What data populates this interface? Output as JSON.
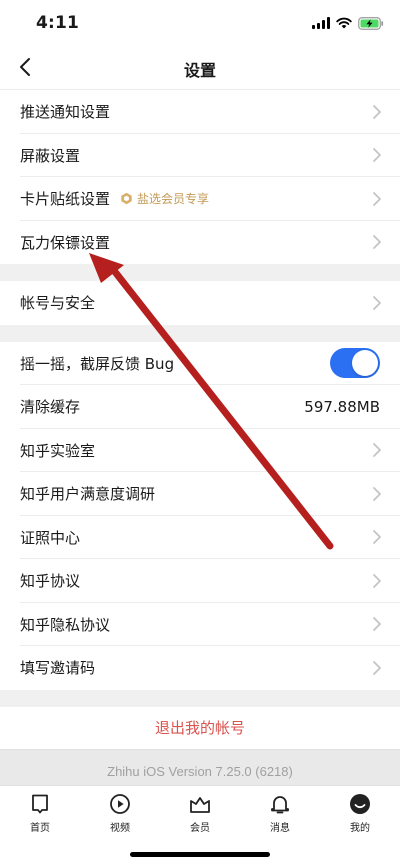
{
  "status": {
    "time": "4:11"
  },
  "nav": {
    "title": "设置"
  },
  "group1": [
    {
      "label": "推送通知设置"
    },
    {
      "label": "屏蔽设置"
    },
    {
      "label": "卡片贴纸设置",
      "badge": "盐选会员专享"
    },
    {
      "label": "瓦力保镖设置"
    }
  ],
  "group2": [
    {
      "label": "帐号与安全"
    }
  ],
  "group3": {
    "shake": {
      "label": "摇一摇，截屏反馈 Bug",
      "enabled": true
    },
    "cache": {
      "label": "清除缓存",
      "value": "597.88MB"
    },
    "items": [
      {
        "label": "知乎实验室"
      },
      {
        "label": "知乎用户满意度调研"
      },
      {
        "label": "证照中心"
      },
      {
        "label": "知乎协议"
      },
      {
        "label": "知乎隐私协议"
      },
      {
        "label": "填写邀请码"
      }
    ]
  },
  "logout": {
    "label": "退出我的帐号"
  },
  "version": {
    "text": "Zhihu iOS Version 7.25.0 (6218)"
  },
  "tabs": [
    {
      "label": "首页",
      "icon": "home-icon"
    },
    {
      "label": "视频",
      "icon": "video-icon"
    },
    {
      "label": "会员",
      "icon": "vip-icon"
    },
    {
      "label": "消息",
      "icon": "bell-icon"
    },
    {
      "label": "我的",
      "icon": "profile-icon"
    }
  ],
  "colors": {
    "accent": "#2b6ff2",
    "logout": "#d9534f",
    "badge": "#c39a55",
    "arrow": "#b5201e",
    "battery": "#4cd964"
  }
}
